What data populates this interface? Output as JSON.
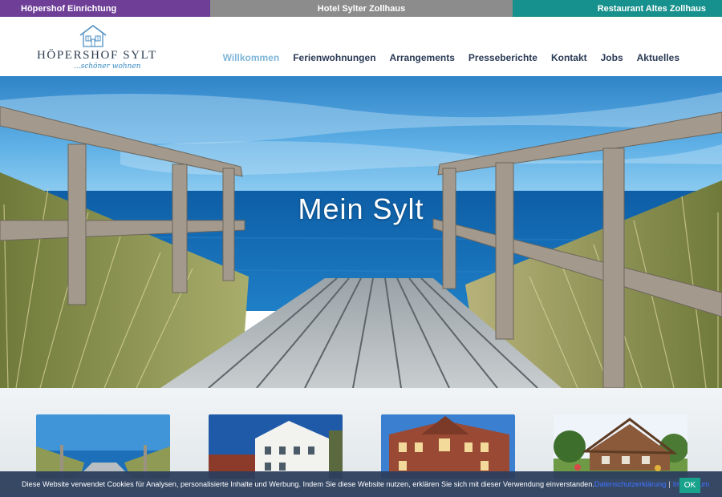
{
  "topbar": {
    "left": "Höpershof Einrichtung",
    "center": "Hotel Sylter Zollhaus",
    "right": "Restaurant Altes Zollhaus"
  },
  "logo": {
    "name": "HÖPERSHOF SYLT",
    "tagline": "...schöner wohnen"
  },
  "nav": {
    "items": [
      "Willkommen",
      "Ferienwohnungen",
      "Arrangements",
      "Presseberichte",
      "Kontakt",
      "Jobs",
      "Aktuelles"
    ],
    "active": "Willkommen"
  },
  "hero": {
    "title": "Mein Sylt"
  },
  "cookie": {
    "text": "Diese Website verwendet Cookies für Analysen, personalisierte Inhalte und Werbung. Indem Sie diese Website nutzen, erklären Sie sich mit dieser Verwendung einverstanden.",
    "privacy_link": "Datenschutzerklärung",
    "separator": "|",
    "imprint_link": "Impressum",
    "ok_label": "OK"
  },
  "colors": {
    "topbar_left": "#6f3f98",
    "topbar_center": "#8c8c8c",
    "topbar_right": "#17918d",
    "nav_text": "#2a3a56",
    "nav_active": "#7fb6da",
    "cookie_bg": "#2c3e5c",
    "cookie_ok": "#19a38d"
  }
}
